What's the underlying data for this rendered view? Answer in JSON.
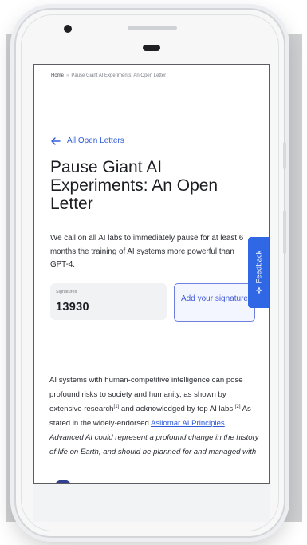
{
  "breadcrumb": {
    "home": "Home",
    "separator": "»",
    "current": "Pause Giant AI Experiments: An Open Letter"
  },
  "back_link": {
    "icon": "arrow-left-icon",
    "label": "All Open Letters"
  },
  "page_title": "Pause Giant AI Experiments: An Open Letter",
  "lede": "We call on all AI labs to immediately pause for at least 6 months the training of AI systems more powerful than GPT-4.",
  "signatures": {
    "label": "Signatures",
    "count": "13930"
  },
  "add_signature_button": "Add your signature",
  "feedback_tab": {
    "icon": "sparkle-icon",
    "label": "Feedback"
  },
  "body": {
    "p1_start": "AI systems with human-competitive intelligence can pose profound risks to society and humanity, as shown by extensive research",
    "ref1": "[1]",
    "p1_mid": " and acknowledged by top AI labs.",
    "ref2": "[2]",
    "p1_mid2": " As stated in the widely-endorsed ",
    "link": "Asilomar AI Principles",
    "p1_sep": ", ",
    "italic": "Advanced AI could represent a profound change in the history of life on Earth, and should be planned for and managed with"
  },
  "colors": {
    "accent": "#2e5bd8",
    "feedback": "#2f67e5",
    "button_border": "#6f7fe0",
    "text": "#1c1d22"
  }
}
